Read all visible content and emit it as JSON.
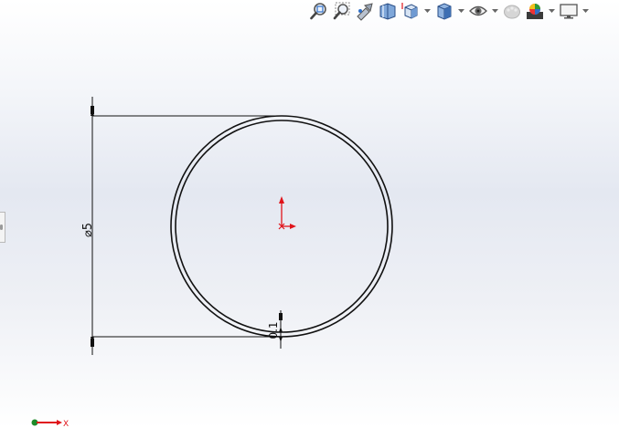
{
  "toolbar": {
    "buttons": [
      {
        "name": "zoom-to-fit",
        "icon": "zoom-to-fit-icon"
      },
      {
        "name": "zoom-to-area",
        "icon": "zoom-to-area-icon"
      },
      {
        "name": "previous-view",
        "icon": "previous-view-icon"
      },
      {
        "name": "section-view",
        "icon": "section-view-icon"
      },
      {
        "name": "view-orientation",
        "icon": "view-orientation-icon",
        "dropdown": true
      },
      {
        "name": "display-style",
        "icon": "display-style-icon",
        "dropdown": true
      },
      {
        "name": "hide-show-items",
        "icon": "eye-icon",
        "dropdown": true
      },
      {
        "name": "edit-appearance",
        "icon": "appearance-icon"
      },
      {
        "name": "apply-scene",
        "icon": "scene-icon",
        "dropdown": true
      },
      {
        "name": "view-settings",
        "icon": "monitor-icon",
        "dropdown": true
      }
    ]
  },
  "sketch": {
    "diameter_dimension": "⌀5",
    "thickness_dimension": "0.1",
    "origin_color": "#e0141b",
    "geometry_color": "#111111"
  },
  "triad": {
    "x_label": "X",
    "x_color": "#e0141b",
    "origin_color": "#1e8a2a"
  },
  "colors": {
    "accent_blue": "#2f6fc9"
  }
}
